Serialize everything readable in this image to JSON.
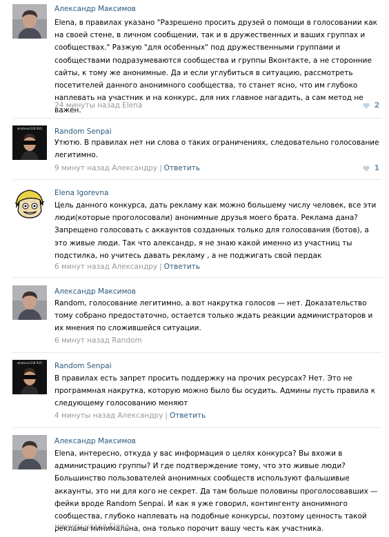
{
  "comments": [
    {
      "author": "Александр Максимов",
      "text": "Elena, в правилах указано \"Разрешено просить друзей о помощи в голосовании как на своей стене, в личном сообщении, так и в дружественных и ваших группах и сообществах.\" Разжую \"для особенных\" под дружественными группами и сообществами подразумеваются сообщества и группы Вконтакте, а не сторонние сайты, к тому же анонимные. Да и если углубиться в ситуацию, рассмотреть посетителей данного анонимного сообщества, то станет ясно, что им глубоко наплевать на участник и на конкурс, для них главное нагадить, а сам метод не важен.",
      "meta": "24 минуты назад Elena",
      "likes": "2",
      "avatar_icon": "young-man-photo"
    },
    {
      "author": "Random Senpai",
      "text": "Утютю. В правилах нет ни слова о таких ограничениях, следовательно голосование легитимно.",
      "meta": "9 минут назад Александру",
      "reply": "Ответить",
      "likes": "1",
      "avatar_icon": "sunglasses-avatar",
      "avatar_caption": "whatever228 RUS"
    },
    {
      "author": "Elena Igorevna",
      "text": "Цель данного конкурса, дать рекламу как можно большему числу человек, все эти люди(которые проголосовали) анонимные друзья моего брата. Реклама дана? Запрещено голосовать с аккаунтов созданных только для голосования (ботов), а это живые люди. Так что александр, я не знаю какой именно из участниц ты подстилка, но учитесь давать рекламу , а не поджигать свой пердак",
      "meta": "6 минут назад Александру",
      "reply": "Ответить",
      "avatar_icon": "cartoon-elf-avatar"
    },
    {
      "author": "Александр Максимов",
      "text": "Random, голосование легитимно, а вот накрутка голосов — нет. Доказательство тому собрано предостаточно, остается только ждать реакции администраторов и их мнения по сложившейся ситуации.",
      "meta": "6 минут назад Random",
      "avatar_icon": "young-man-photo"
    },
    {
      "author": "Random Senpai",
      "text": "В правилах есть запрет просить поддержку на прочих ресурсах? Нет. Это не программная накрутка, которую можно было бы осудить. Админы пусть правила к следующему голосованию меняют",
      "meta": "4 минуты назад Александру",
      "reply": "Ответить",
      "avatar_icon": "sunglasses-avatar",
      "avatar_caption": "whatever228 RUS"
    },
    {
      "author": "Александр Максимов",
      "text": "Elena, интересно, откуда у вас информация о целях конкурса? Вы вхожи в администрацию группы? И где подтверждение тому, что это живые люди? Большинство пользователей анонимных сообществ используют фальшивые аккаунты, это ни для кого не секрет. Да там больше половины проголосовавших — фейки вроде Random Senpai. И как я уже говорил, контингенту анонимного сообщества, глубоко наплевать на подобные конкурсы, поэтому ценность такой рекламы минимальна, она только порочит вашу честь как участника.",
      "meta": "минуту назад Elena",
      "avatar_icon": "young-man-photo"
    }
  ],
  "colors": {
    "link": "#2b587a",
    "meta": "#999999",
    "divider": "#e7e8ec",
    "like": "#6b8fad"
  }
}
